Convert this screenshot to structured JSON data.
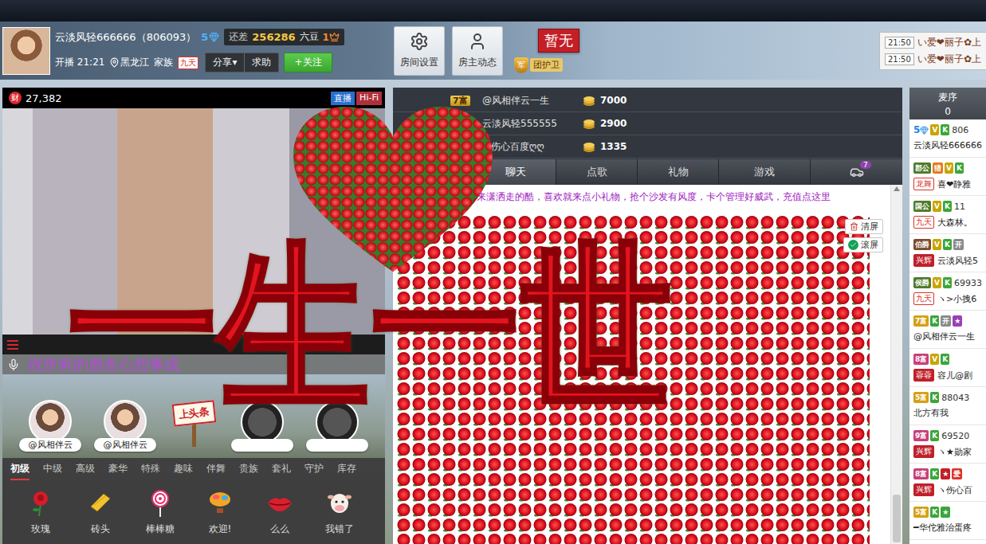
{
  "header": {
    "name": "云淡风轻666666（806093）",
    "level": "5",
    "gap_label": "还差",
    "gap_value": "256286",
    "gap_unit": "六豆",
    "crown_level": "1",
    "start_label": "开播",
    "start_time": "21:21",
    "location": "黑龙江",
    "family_label": "家族",
    "family": "九天",
    "share": "分享",
    "share_caret": "▾",
    "help": "求助",
    "follow": "+关注"
  },
  "room_buttons": [
    {
      "label": "房间设置",
      "kind": "settings"
    },
    {
      "label": "房主动态",
      "kind": "profile"
    }
  ],
  "guard": {
    "status": "暂无",
    "badge": "军",
    "label": "团护卫"
  },
  "notifications": [
    {
      "time": "21:50",
      "text": "い爱❤丽子✿上"
    },
    {
      "time": "21:50",
      "text": "い爱❤丽子✿上"
    }
  ],
  "video": {
    "wealth_icon": "财",
    "wealth": "27,382",
    "live": "直播",
    "quality": "Hi-Fi"
  },
  "blessing": "祝所有的朋友心想事成",
  "headline_slots": [
    {
      "kind": "avatar",
      "label": "@风相伴云"
    },
    {
      "kind": "avatar",
      "label": "@风相伴云"
    },
    {
      "kind": "sign",
      "label": "上头条"
    },
    {
      "kind": "empty"
    },
    {
      "kind": "empty"
    }
  ],
  "gift_tabs": [
    {
      "label": "初级",
      "selected": true
    },
    {
      "label": "中级",
      "selected": false
    },
    {
      "label": "高级",
      "selected": false
    },
    {
      "label": "豪华",
      "selected": false
    },
    {
      "label": "特殊",
      "selected": false
    },
    {
      "label": "趣味",
      "selected": false
    },
    {
      "label": "伴舞",
      "selected": false
    },
    {
      "label": "贵族",
      "selected": false
    },
    {
      "label": "套礼",
      "selected": false
    },
    {
      "label": "守护",
      "selected": false
    },
    {
      "label": "库存",
      "selected": false
    }
  ],
  "gifts": [
    {
      "label": "玫瑰",
      "kind": "rose"
    },
    {
      "label": "砖头",
      "kind": "brick"
    },
    {
      "label": "棒棒糖",
      "kind": "lollipop"
    },
    {
      "label": "欢迎!",
      "kind": "balloon"
    },
    {
      "label": "么么",
      "kind": "lips"
    },
    {
      "label": "我错了",
      "kind": "cow"
    }
  ],
  "rank": [
    {
      "badge": "7富",
      "name": "@风相伴云一生",
      "amount": "7000"
    },
    {
      "name": "云淡风轻555555",
      "amount": "2900"
    },
    {
      "name": "♥伤心百度ღღ",
      "amount": "1335"
    }
  ],
  "chat_tabs": [
    {
      "kind": "text",
      "label": "聊天",
      "selected": true
    },
    {
      "kind": "text",
      "label": "点歌",
      "selected": false
    },
    {
      "kind": "text",
      "label": "礼物",
      "selected": false
    },
    {
      "kind": "text",
      "label": "游戏",
      "selected": false
    },
    {
      "kind": "car",
      "count": "7",
      "selected": false
    }
  ],
  "chat": {
    "notice": "来潇洒走的酷，喜欢就来点小礼物，抢个沙发有风度，卡个管理好威武，充值点这里",
    "clear": "清屏",
    "scroll": "滚屏",
    "scroll_on": true
  },
  "overlay": {
    "text": "一生一世"
  },
  "queue": {
    "label": "麦序",
    "count": "0"
  },
  "users": [
    {
      "badges": [
        {
          "text": "5",
          "color": "#1e88e5",
          "kind": "diamond"
        },
        {
          "text": "V",
          "color": "#c9a400",
          "kind": "tag"
        },
        {
          "text": "K",
          "color": "#3aa63a",
          "kind": "tag"
        }
      ],
      "id": "806",
      "name": "云淡风轻666666"
    },
    {
      "badges": [
        {
          "text": "郡公",
          "color": "#4f7a2a",
          "kind": "tag"
        },
        {
          "text": "猎",
          "color": "#e07a1a",
          "kind": "tag"
        },
        {
          "text": "V",
          "color": "#c9a400",
          "kind": "tag"
        },
        {
          "text": "K",
          "color": "#3aa63a",
          "kind": "tag"
        }
      ],
      "family": {
        "text": "龙舞",
        "color": "#d9342b",
        "kind": "outline"
      },
      "name": "喜❤静雅"
    },
    {
      "badges": [
        {
          "text": "国公",
          "color": "#4f7a2a",
          "kind": "tag"
        },
        {
          "text": "V",
          "color": "#c9a400",
          "kind": "tag"
        },
        {
          "text": "K",
          "color": "#3aa63a",
          "kind": "tag"
        }
      ],
      "id": "11",
      "family": {
        "text": "九天",
        "color": "#d9342b",
        "kind": "outline"
      },
      "name": "大森林。"
    },
    {
      "badges": [
        {
          "text": "伯爵",
          "color": "#7a4a2a",
          "kind": "tag"
        },
        {
          "text": "V",
          "color": "#c9a400",
          "kind": "tag"
        },
        {
          "text": "K",
          "color": "#3aa63a",
          "kind": "tag"
        },
        {
          "text": "开",
          "color": "#8a8a8a",
          "kind": "tag"
        }
      ],
      "family": {
        "text": "兴辉",
        "color": "#c0202a",
        "kind": "solid"
      },
      "name": "云淡风轻5"
    },
    {
      "badges": [
        {
          "text": "侯爵",
          "color": "#4f7a2a",
          "kind": "tag"
        },
        {
          "text": "V",
          "color": "#c9a400",
          "kind": "tag"
        },
        {
          "text": "K",
          "color": "#3aa63a",
          "kind": "tag"
        }
      ],
      "id": "69933",
      "family": {
        "text": "九天",
        "color": "#d9342b",
        "kind": "outline"
      },
      "name": "ヽ>小拽6"
    },
    {
      "badges": [
        {
          "text": "7富",
          "color": "#d4a017",
          "kind": "tag"
        },
        {
          "text": "K",
          "color": "#3aa63a",
          "kind": "tag"
        },
        {
          "text": "开",
          "color": "#8a8a8a",
          "kind": "tag"
        },
        {
          "text": "★",
          "color": "#9b3fb5",
          "kind": "tag"
        }
      ],
      "name": "@风相伴云一生"
    },
    {
      "badges": [
        {
          "text": "8富",
          "color": "#c8407a",
          "kind": "tag"
        },
        {
          "text": "V",
          "color": "#c9a400",
          "kind": "tag"
        },
        {
          "text": "K",
          "color": "#3aa63a",
          "kind": "tag"
        }
      ],
      "family": {
        "text": "蓉蓉",
        "color": "#c0202a",
        "kind": "solid"
      },
      "name": "容儿@剧"
    },
    {
      "badges": [
        {
          "text": "5富",
          "color": "#d4a017",
          "kind": "tag"
        },
        {
          "text": "K",
          "color": "#3aa63a",
          "kind": "tag"
        }
      ],
      "id": "88043",
      "name": "北方有我"
    },
    {
      "badges": [
        {
          "text": "9富",
          "color": "#c8407a",
          "kind": "tag"
        },
        {
          "text": "K",
          "color": "#3aa63a",
          "kind": "tag"
        }
      ],
      "id": "69520",
      "family": {
        "text": "兴辉",
        "color": "#c0202a",
        "kind": "solid"
      },
      "name": "ヽ★勋家"
    },
    {
      "badges": [
        {
          "text": "8富",
          "color": "#c8407a",
          "kind": "tag"
        },
        {
          "text": "K",
          "color": "#3aa63a",
          "kind": "tag"
        },
        {
          "text": "★",
          "color": "#c0202a",
          "kind": "tag"
        },
        {
          "text": "爱",
          "color": "#d9342b",
          "kind": "tag"
        }
      ],
      "family": {
        "text": "兴辉",
        "color": "#c0202a",
        "kind": "solid"
      },
      "name": "ヽ伤心百"
    },
    {
      "badges": [
        {
          "text": "5富",
          "color": "#d4a017",
          "kind": "tag"
        },
        {
          "text": "K",
          "color": "#3aa63a",
          "kind": "tag"
        },
        {
          "text": "★",
          "color": "#3aa63a",
          "kind": "tag"
        }
      ],
      "name": "━华佗雅治蛋疼"
    }
  ]
}
